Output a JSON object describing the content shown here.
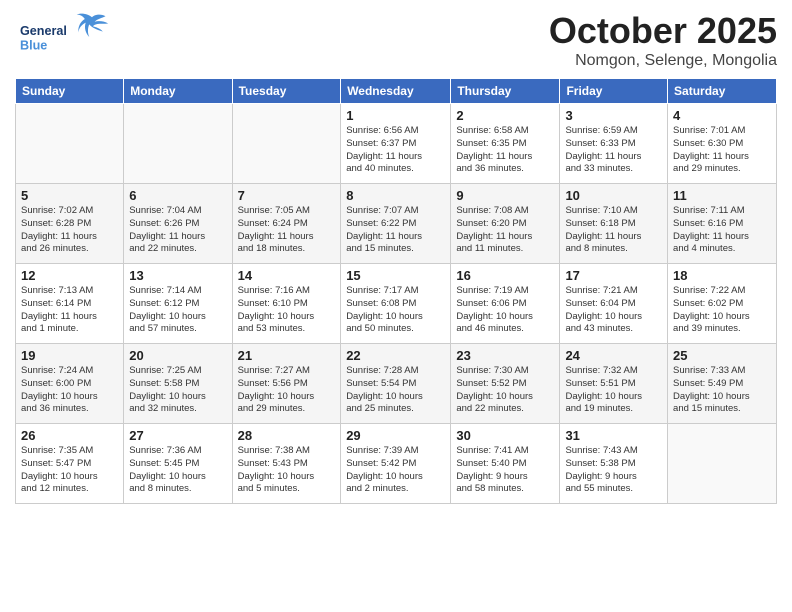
{
  "header": {
    "logo_general": "General",
    "logo_blue": "Blue",
    "month_title": "October 2025",
    "subtitle": "Nomgon, Selenge, Mongolia"
  },
  "days_of_week": [
    "Sunday",
    "Monday",
    "Tuesday",
    "Wednesday",
    "Thursday",
    "Friday",
    "Saturday"
  ],
  "weeks": [
    [
      {
        "day": "",
        "info": ""
      },
      {
        "day": "",
        "info": ""
      },
      {
        "day": "",
        "info": ""
      },
      {
        "day": "1",
        "info": "Sunrise: 6:56 AM\nSunset: 6:37 PM\nDaylight: 11 hours\nand 40 minutes."
      },
      {
        "day": "2",
        "info": "Sunrise: 6:58 AM\nSunset: 6:35 PM\nDaylight: 11 hours\nand 36 minutes."
      },
      {
        "day": "3",
        "info": "Sunrise: 6:59 AM\nSunset: 6:33 PM\nDaylight: 11 hours\nand 33 minutes."
      },
      {
        "day": "4",
        "info": "Sunrise: 7:01 AM\nSunset: 6:30 PM\nDaylight: 11 hours\nand 29 minutes."
      }
    ],
    [
      {
        "day": "5",
        "info": "Sunrise: 7:02 AM\nSunset: 6:28 PM\nDaylight: 11 hours\nand 26 minutes."
      },
      {
        "day": "6",
        "info": "Sunrise: 7:04 AM\nSunset: 6:26 PM\nDaylight: 11 hours\nand 22 minutes."
      },
      {
        "day": "7",
        "info": "Sunrise: 7:05 AM\nSunset: 6:24 PM\nDaylight: 11 hours\nand 18 minutes."
      },
      {
        "day": "8",
        "info": "Sunrise: 7:07 AM\nSunset: 6:22 PM\nDaylight: 11 hours\nand 15 minutes."
      },
      {
        "day": "9",
        "info": "Sunrise: 7:08 AM\nSunset: 6:20 PM\nDaylight: 11 hours\nand 11 minutes."
      },
      {
        "day": "10",
        "info": "Sunrise: 7:10 AM\nSunset: 6:18 PM\nDaylight: 11 hours\nand 8 minutes."
      },
      {
        "day": "11",
        "info": "Sunrise: 7:11 AM\nSunset: 6:16 PM\nDaylight: 11 hours\nand 4 minutes."
      }
    ],
    [
      {
        "day": "12",
        "info": "Sunrise: 7:13 AM\nSunset: 6:14 PM\nDaylight: 11 hours\nand 1 minute."
      },
      {
        "day": "13",
        "info": "Sunrise: 7:14 AM\nSunset: 6:12 PM\nDaylight: 10 hours\nand 57 minutes."
      },
      {
        "day": "14",
        "info": "Sunrise: 7:16 AM\nSunset: 6:10 PM\nDaylight: 10 hours\nand 53 minutes."
      },
      {
        "day": "15",
        "info": "Sunrise: 7:17 AM\nSunset: 6:08 PM\nDaylight: 10 hours\nand 50 minutes."
      },
      {
        "day": "16",
        "info": "Sunrise: 7:19 AM\nSunset: 6:06 PM\nDaylight: 10 hours\nand 46 minutes."
      },
      {
        "day": "17",
        "info": "Sunrise: 7:21 AM\nSunset: 6:04 PM\nDaylight: 10 hours\nand 43 minutes."
      },
      {
        "day": "18",
        "info": "Sunrise: 7:22 AM\nSunset: 6:02 PM\nDaylight: 10 hours\nand 39 minutes."
      }
    ],
    [
      {
        "day": "19",
        "info": "Sunrise: 7:24 AM\nSunset: 6:00 PM\nDaylight: 10 hours\nand 36 minutes."
      },
      {
        "day": "20",
        "info": "Sunrise: 7:25 AM\nSunset: 5:58 PM\nDaylight: 10 hours\nand 32 minutes."
      },
      {
        "day": "21",
        "info": "Sunrise: 7:27 AM\nSunset: 5:56 PM\nDaylight: 10 hours\nand 29 minutes."
      },
      {
        "day": "22",
        "info": "Sunrise: 7:28 AM\nSunset: 5:54 PM\nDaylight: 10 hours\nand 25 minutes."
      },
      {
        "day": "23",
        "info": "Sunrise: 7:30 AM\nSunset: 5:52 PM\nDaylight: 10 hours\nand 22 minutes."
      },
      {
        "day": "24",
        "info": "Sunrise: 7:32 AM\nSunset: 5:51 PM\nDaylight: 10 hours\nand 19 minutes."
      },
      {
        "day": "25",
        "info": "Sunrise: 7:33 AM\nSunset: 5:49 PM\nDaylight: 10 hours\nand 15 minutes."
      }
    ],
    [
      {
        "day": "26",
        "info": "Sunrise: 7:35 AM\nSunset: 5:47 PM\nDaylight: 10 hours\nand 12 minutes."
      },
      {
        "day": "27",
        "info": "Sunrise: 7:36 AM\nSunset: 5:45 PM\nDaylight: 10 hours\nand 8 minutes."
      },
      {
        "day": "28",
        "info": "Sunrise: 7:38 AM\nSunset: 5:43 PM\nDaylight: 10 hours\nand 5 minutes."
      },
      {
        "day": "29",
        "info": "Sunrise: 7:39 AM\nSunset: 5:42 PM\nDaylight: 10 hours\nand 2 minutes."
      },
      {
        "day": "30",
        "info": "Sunrise: 7:41 AM\nSunset: 5:40 PM\nDaylight: 9 hours\nand 58 minutes."
      },
      {
        "day": "31",
        "info": "Sunrise: 7:43 AM\nSunset: 5:38 PM\nDaylight: 9 hours\nand 55 minutes."
      },
      {
        "day": "",
        "info": ""
      }
    ]
  ]
}
